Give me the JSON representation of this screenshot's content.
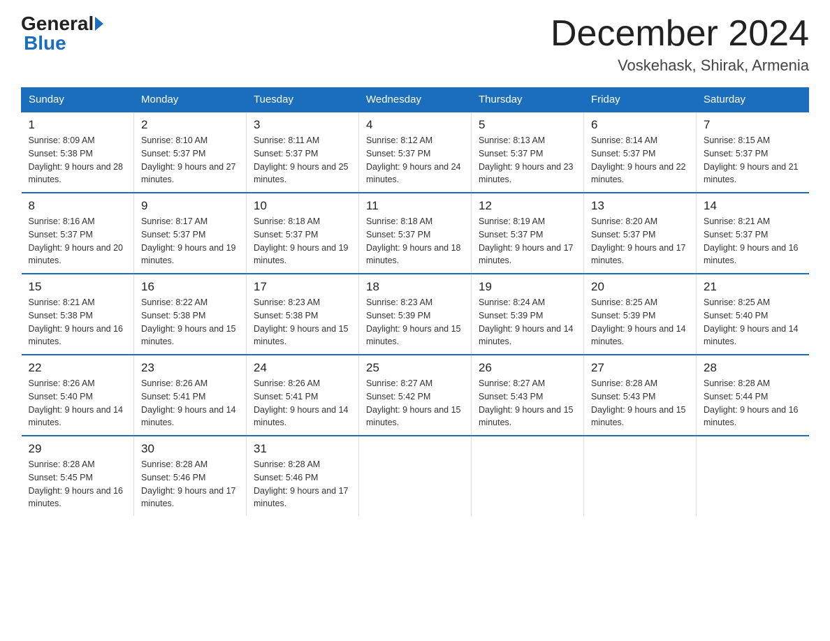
{
  "header": {
    "logo_general": "General",
    "logo_blue": "Blue",
    "month_title": "December 2024",
    "location": "Voskehask, Shirak, Armenia"
  },
  "weekdays": [
    "Sunday",
    "Monday",
    "Tuesday",
    "Wednesday",
    "Thursday",
    "Friday",
    "Saturday"
  ],
  "weeks": [
    [
      {
        "day": "1",
        "sunrise": "Sunrise: 8:09 AM",
        "sunset": "Sunset: 5:38 PM",
        "daylight": "Daylight: 9 hours and 28 minutes."
      },
      {
        "day": "2",
        "sunrise": "Sunrise: 8:10 AM",
        "sunset": "Sunset: 5:37 PM",
        "daylight": "Daylight: 9 hours and 27 minutes."
      },
      {
        "day": "3",
        "sunrise": "Sunrise: 8:11 AM",
        "sunset": "Sunset: 5:37 PM",
        "daylight": "Daylight: 9 hours and 25 minutes."
      },
      {
        "day": "4",
        "sunrise": "Sunrise: 8:12 AM",
        "sunset": "Sunset: 5:37 PM",
        "daylight": "Daylight: 9 hours and 24 minutes."
      },
      {
        "day": "5",
        "sunrise": "Sunrise: 8:13 AM",
        "sunset": "Sunset: 5:37 PM",
        "daylight": "Daylight: 9 hours and 23 minutes."
      },
      {
        "day": "6",
        "sunrise": "Sunrise: 8:14 AM",
        "sunset": "Sunset: 5:37 PM",
        "daylight": "Daylight: 9 hours and 22 minutes."
      },
      {
        "day": "7",
        "sunrise": "Sunrise: 8:15 AM",
        "sunset": "Sunset: 5:37 PM",
        "daylight": "Daylight: 9 hours and 21 minutes."
      }
    ],
    [
      {
        "day": "8",
        "sunrise": "Sunrise: 8:16 AM",
        "sunset": "Sunset: 5:37 PM",
        "daylight": "Daylight: 9 hours and 20 minutes."
      },
      {
        "day": "9",
        "sunrise": "Sunrise: 8:17 AM",
        "sunset": "Sunset: 5:37 PM",
        "daylight": "Daylight: 9 hours and 19 minutes."
      },
      {
        "day": "10",
        "sunrise": "Sunrise: 8:18 AM",
        "sunset": "Sunset: 5:37 PM",
        "daylight": "Daylight: 9 hours and 19 minutes."
      },
      {
        "day": "11",
        "sunrise": "Sunrise: 8:18 AM",
        "sunset": "Sunset: 5:37 PM",
        "daylight": "Daylight: 9 hours and 18 minutes."
      },
      {
        "day": "12",
        "sunrise": "Sunrise: 8:19 AM",
        "sunset": "Sunset: 5:37 PM",
        "daylight": "Daylight: 9 hours and 17 minutes."
      },
      {
        "day": "13",
        "sunrise": "Sunrise: 8:20 AM",
        "sunset": "Sunset: 5:37 PM",
        "daylight": "Daylight: 9 hours and 17 minutes."
      },
      {
        "day": "14",
        "sunrise": "Sunrise: 8:21 AM",
        "sunset": "Sunset: 5:37 PM",
        "daylight": "Daylight: 9 hours and 16 minutes."
      }
    ],
    [
      {
        "day": "15",
        "sunrise": "Sunrise: 8:21 AM",
        "sunset": "Sunset: 5:38 PM",
        "daylight": "Daylight: 9 hours and 16 minutes."
      },
      {
        "day": "16",
        "sunrise": "Sunrise: 8:22 AM",
        "sunset": "Sunset: 5:38 PM",
        "daylight": "Daylight: 9 hours and 15 minutes."
      },
      {
        "day": "17",
        "sunrise": "Sunrise: 8:23 AM",
        "sunset": "Sunset: 5:38 PM",
        "daylight": "Daylight: 9 hours and 15 minutes."
      },
      {
        "day": "18",
        "sunrise": "Sunrise: 8:23 AM",
        "sunset": "Sunset: 5:39 PM",
        "daylight": "Daylight: 9 hours and 15 minutes."
      },
      {
        "day": "19",
        "sunrise": "Sunrise: 8:24 AM",
        "sunset": "Sunset: 5:39 PM",
        "daylight": "Daylight: 9 hours and 14 minutes."
      },
      {
        "day": "20",
        "sunrise": "Sunrise: 8:25 AM",
        "sunset": "Sunset: 5:39 PM",
        "daylight": "Daylight: 9 hours and 14 minutes."
      },
      {
        "day": "21",
        "sunrise": "Sunrise: 8:25 AM",
        "sunset": "Sunset: 5:40 PM",
        "daylight": "Daylight: 9 hours and 14 minutes."
      }
    ],
    [
      {
        "day": "22",
        "sunrise": "Sunrise: 8:26 AM",
        "sunset": "Sunset: 5:40 PM",
        "daylight": "Daylight: 9 hours and 14 minutes."
      },
      {
        "day": "23",
        "sunrise": "Sunrise: 8:26 AM",
        "sunset": "Sunset: 5:41 PM",
        "daylight": "Daylight: 9 hours and 14 minutes."
      },
      {
        "day": "24",
        "sunrise": "Sunrise: 8:26 AM",
        "sunset": "Sunset: 5:41 PM",
        "daylight": "Daylight: 9 hours and 14 minutes."
      },
      {
        "day": "25",
        "sunrise": "Sunrise: 8:27 AM",
        "sunset": "Sunset: 5:42 PM",
        "daylight": "Daylight: 9 hours and 15 minutes."
      },
      {
        "day": "26",
        "sunrise": "Sunrise: 8:27 AM",
        "sunset": "Sunset: 5:43 PM",
        "daylight": "Daylight: 9 hours and 15 minutes."
      },
      {
        "day": "27",
        "sunrise": "Sunrise: 8:28 AM",
        "sunset": "Sunset: 5:43 PM",
        "daylight": "Daylight: 9 hours and 15 minutes."
      },
      {
        "day": "28",
        "sunrise": "Sunrise: 8:28 AM",
        "sunset": "Sunset: 5:44 PM",
        "daylight": "Daylight: 9 hours and 16 minutes."
      }
    ],
    [
      {
        "day": "29",
        "sunrise": "Sunrise: 8:28 AM",
        "sunset": "Sunset: 5:45 PM",
        "daylight": "Daylight: 9 hours and 16 minutes."
      },
      {
        "day": "30",
        "sunrise": "Sunrise: 8:28 AM",
        "sunset": "Sunset: 5:46 PM",
        "daylight": "Daylight: 9 hours and 17 minutes."
      },
      {
        "day": "31",
        "sunrise": "Sunrise: 8:28 AM",
        "sunset": "Sunset: 5:46 PM",
        "daylight": "Daylight: 9 hours and 17 minutes."
      },
      null,
      null,
      null,
      null
    ]
  ]
}
